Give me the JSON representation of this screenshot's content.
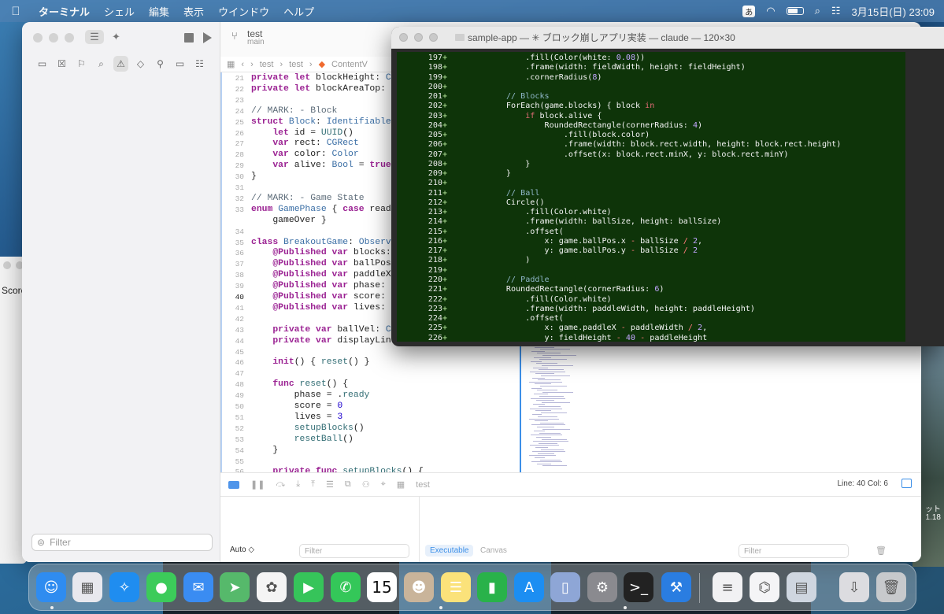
{
  "menubar": {
    "app": "ターミナル",
    "items": [
      "シェル",
      "編集",
      "表示",
      "ウインドウ",
      "ヘルプ"
    ],
    "ime": "あ",
    "clock": "3月15日(日)  23:09"
  },
  "side_window": {
    "label": "Score"
  },
  "xcode": {
    "project": "test",
    "branch": "main",
    "breadcrumb": [
      "test",
      "test",
      "ContentV"
    ],
    "sidebar_filter_placeholder": "Filter",
    "editor_lines": [
      {
        "n": "21",
        "html": "<span class=\"kw\">private</span> <span class=\"kw\">let</span> blockHeight: <span class=\"ty\">CGFlo</span>"
      },
      {
        "n": "22",
        "html": "<span class=\"kw\">private</span> <span class=\"kw\">let</span> blockAreaTop: <span class=\"ty\">CGFl</span>"
      },
      {
        "n": "23",
        "html": ""
      },
      {
        "n": "24",
        "html": "<span class=\"cm\">// MARK: - Block</span>"
      },
      {
        "n": "25",
        "html": "<span class=\"kw\">struct</span> <span class=\"ty\">Block</span>: <span class=\"ty\">Identifiable</span> {"
      },
      {
        "n": "26",
        "html": "    <span class=\"kw\">let</span> id = <span class=\"fn\">UUID</span>()"
      },
      {
        "n": "27",
        "html": "    <span class=\"kw\">var</span> rect: <span class=\"ty\">CGRect</span>"
      },
      {
        "n": "28",
        "html": "    <span class=\"kw\">var</span> color: <span class=\"ty\">Color</span>"
      },
      {
        "n": "29",
        "html": "    <span class=\"kw\">var</span> alive: <span class=\"ty\">Bool</span> = <span class=\"kw\">true</span>"
      },
      {
        "n": "30",
        "html": "}"
      },
      {
        "n": "31",
        "html": ""
      },
      {
        "n": "32",
        "html": "<span class=\"cm\">// MARK: - Game State</span>"
      },
      {
        "n": "33",
        "html": "<span class=\"kw\">enum</span> <span class=\"ty\">GamePhase</span> { <span class=\"kw\">case</span> ready, p"
      },
      {
        "n": "",
        "html": "    gameOver }"
      },
      {
        "n": "34",
        "html": ""
      },
      {
        "n": "35",
        "html": "<span class=\"kw\">class</span> <span class=\"ty\">BreakoutGame</span>: <span class=\"ty\">Observable</span>"
      },
      {
        "n": "36",
        "html": "    <span class=\"kw\">@Published</span> <span class=\"kw\">var</span> blocks: [Bl"
      },
      {
        "n": "37",
        "html": "    <span class=\"kw\">@Published</span> <span class=\"kw\">var</span> ballPos: <span class=\"ty\">CG</span>"
      },
      {
        "n": "38",
        "html": "    <span class=\"kw\">@Published</span> <span class=\"kw\">var</span> paddleX: <span class=\"ty\">CG</span>"
      },
      {
        "n": "39",
        "html": "    <span class=\"kw\">@Published</span> <span class=\"kw\">var</span> phase: <span class=\"ty\">Game</span>"
      },
      {
        "n": "40",
        "html": "    <span class=\"kw\">@Published</span> <span class=\"kw\">var</span> score: <span class=\"ty\">Int</span>"
      },
      {
        "n": "41",
        "html": "    <span class=\"kw\">@Published</span> <span class=\"kw\">var</span> lives: <span class=\"ty\">Int</span>"
      },
      {
        "n": "42",
        "html": ""
      },
      {
        "n": "43",
        "html": "    <span class=\"kw\">private</span> <span class=\"kw\">var</span> ballVel: <span class=\"ty\">CGPoi</span>"
      },
      {
        "n": "44",
        "html": "    <span class=\"kw\">private</span> <span class=\"kw\">var</span> displayLink: <span class=\"ty\">T</span>"
      },
      {
        "n": "45",
        "html": ""
      },
      {
        "n": "46",
        "html": "    <span class=\"kw\">init</span>() { <span class=\"fn\">reset</span>() }"
      },
      {
        "n": "47",
        "html": ""
      },
      {
        "n": "48",
        "html": "    <span class=\"kw\">func</span> <span class=\"fn\">reset</span>() {"
      },
      {
        "n": "49",
        "html": "        phase = .<span class=\"fn\">ready</span>"
      },
      {
        "n": "50",
        "html": "        score = <span class=\"nm\">0</span>"
      },
      {
        "n": "51",
        "html": "        lives = <span class=\"nm\">3</span>"
      },
      {
        "n": "52",
        "html": "        <span class=\"fn\">setupBlocks</span>()"
      },
      {
        "n": "53",
        "html": "        <span class=\"fn\">resetBall</span>()"
      },
      {
        "n": "54",
        "html": "    }"
      },
      {
        "n": "55",
        "html": ""
      },
      {
        "n": "56",
        "html": "    <span class=\"kw\">private</span> <span class=\"kw\">func</span> <span class=\"fn\">setupBlocks</span>() {"
      }
    ],
    "current_line": "40",
    "scheme": "test",
    "line_col": "Line: 40  Col: 6",
    "debug": {
      "auto_label": "Auto ◇",
      "filter_placeholder": "Filter",
      "executable": "Executable",
      "canvas": "Canvas",
      "right_filter_placeholder": "Filter"
    }
  },
  "terminal": {
    "title": "sample-app — ✳ ブロック崩しアプリ実装 — claude — 120×30",
    "lines": [
      {
        "n": "197",
        "html": "                .fill(<span>Color</span>(white: <span class=\"nm2\">0.08</span>))"
      },
      {
        "n": "198",
        "html": "                .frame(width: fieldWidth, height: fieldHeight)"
      },
      {
        "n": "199",
        "html": "                .cornerRadius(<span class=\"nm2\">8</span>)"
      },
      {
        "n": "200",
        "html": ""
      },
      {
        "n": "201",
        "html": "            <span class=\"cm2\">// Blocks</span>"
      },
      {
        "n": "202",
        "html": "            ForEach(game.blocks) { block <span class=\"kw2\">in</span>"
      },
      {
        "n": "203",
        "html": "                <span class=\"kw2\">if</span> block.alive {"
      },
      {
        "n": "204",
        "html": "                    RoundedRectangle(cornerRadius: <span class=\"nm2\">4</span>)"
      },
      {
        "n": "205",
        "html": "                        .fill(block.color)"
      },
      {
        "n": "206",
        "html": "                        .frame(width: block.rect.width, height: block.rect.height)"
      },
      {
        "n": "207",
        "html": "                        .offset(x: block.rect.minX, y: block.rect.minY)"
      },
      {
        "n": "208",
        "html": "                }"
      },
      {
        "n": "209",
        "html": "            }"
      },
      {
        "n": "210",
        "html": ""
      },
      {
        "n": "211",
        "html": "            <span class=\"cm2\">// Ball</span>"
      },
      {
        "n": "212",
        "html": "            Circle()"
      },
      {
        "n": "213",
        "html": "                .fill(Color.white)"
      },
      {
        "n": "214",
        "html": "                .frame(width: ballSize, height: ballSize)"
      },
      {
        "n": "215",
        "html": "                .offset("
      },
      {
        "n": "216",
        "html": "                    x: game.ballPos.x <span class=\"op\">-</span> ballSize <span class=\"op\">/</span> <span class=\"nm2\">2</span>,"
      },
      {
        "n": "217",
        "html": "                    y: game.ballPos.y <span class=\"op\">-</span> ballSize <span class=\"op\">/</span> <span class=\"nm2\">2</span>"
      },
      {
        "n": "218",
        "html": "                )"
      },
      {
        "n": "219",
        "html": ""
      },
      {
        "n": "220",
        "html": "            <span class=\"cm2\">// Paddle</span>"
      },
      {
        "n": "221",
        "html": "            RoundedRectangle(cornerRadius: <span class=\"nm2\">6</span>)"
      },
      {
        "n": "222",
        "html": "                .fill(Color.white)"
      },
      {
        "n": "223",
        "html": "                .frame(width: paddleWidth, height: paddleHeight)"
      },
      {
        "n": "224",
        "html": "                .offset("
      },
      {
        "n": "225",
        "html": "                    x: game.paddleX <span class=\"op\">-</span> paddleWidth <span class=\"op\">/</span> <span class=\"nm2\">2</span>,"
      },
      {
        "n": "226",
        "html": "                    y: fieldHeight <span class=\"op\">-</span> <span class=\"nm2\">40</span> <span class=\"op\">-</span> paddleHeight"
      }
    ]
  },
  "wallpaper_right_text": [
    "ット",
    "1.18"
  ],
  "dock": {
    "calendar_day": "15",
    "apps": [
      {
        "name": "finder-icon",
        "color": "#2f8cf0",
        "glyph": "☺"
      },
      {
        "name": "launchpad-icon",
        "color": "#e8e8ee",
        "glyph": "▦"
      },
      {
        "name": "safari-icon",
        "color": "#1f8df0",
        "glyph": "✧"
      },
      {
        "name": "messages-icon",
        "color": "#3ccb5a",
        "glyph": "●"
      },
      {
        "name": "mail-icon",
        "color": "#3a8cf2",
        "glyph": "✉"
      },
      {
        "name": "maps-icon",
        "color": "#56b96b",
        "glyph": "➤"
      },
      {
        "name": "photos-icon",
        "color": "#f4f4f4",
        "glyph": "✿"
      },
      {
        "name": "facetime-icon",
        "color": "#36c45a",
        "glyph": "▶"
      },
      {
        "name": "phone-icon",
        "color": "#34c759",
        "glyph": "✆"
      },
      {
        "name": "calendar-icon",
        "color": "#ffffff",
        "glyph": ""
      },
      {
        "name": "contacts-icon",
        "color": "#c9b49a",
        "glyph": "☻"
      },
      {
        "name": "notes-icon",
        "color": "#fbe27a",
        "glyph": "☰"
      },
      {
        "name": "numbers-icon",
        "color": "#29b24a",
        "glyph": "▮"
      },
      {
        "name": "appstore-icon",
        "color": "#1c8ef2",
        "glyph": "A"
      },
      {
        "name": "simulator-icon",
        "color": "#8ea6d6",
        "glyph": "▯"
      },
      {
        "name": "system-settings-icon",
        "color": "#8a8a8f",
        "glyph": "⚙"
      },
      {
        "name": "terminal-icon",
        "color": "#222222",
        "glyph": ">_"
      },
      {
        "name": "xcode-icon",
        "color": "#2a7de1",
        "glyph": "⚒"
      },
      {
        "name": "textedit-icon",
        "color": "#f1f1f3",
        "glyph": "≡"
      },
      {
        "name": "vscode-icon",
        "color": "#f4f4f6",
        "glyph": "⌬"
      },
      {
        "name": "preview-icon",
        "color": "#cfd6e0",
        "glyph": "▤"
      },
      {
        "name": "downloads-icon",
        "color": "#dcdce0",
        "glyph": "⇩"
      },
      {
        "name": "trash-icon",
        "color": "#c7c9cc",
        "glyph": "🗑"
      }
    ]
  }
}
